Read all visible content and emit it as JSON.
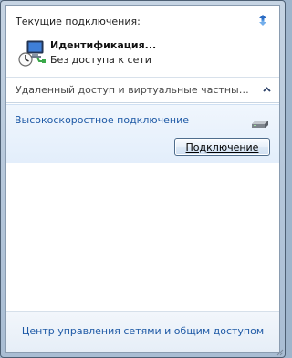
{
  "header": {
    "title": "Текущие подключения:",
    "refresh_icon": "refresh-icon"
  },
  "connection": {
    "name": "Идентификация...",
    "status": "Без доступа к сети",
    "icon": "network-computer-icon"
  },
  "section": {
    "label": "Удаленный доступ и виртуальные частные се...",
    "expanded": true
  },
  "items": [
    {
      "label": "Высокоскоростное подключение",
      "icon": "modem-icon",
      "button_label": "Подключение"
    }
  ],
  "footer": {
    "link_label": "Центр управления сетями и общим доступом"
  },
  "colors": {
    "link": "#1f5aa6",
    "selected_bg": "#e3eefb",
    "frame": "#b3c5d9"
  }
}
